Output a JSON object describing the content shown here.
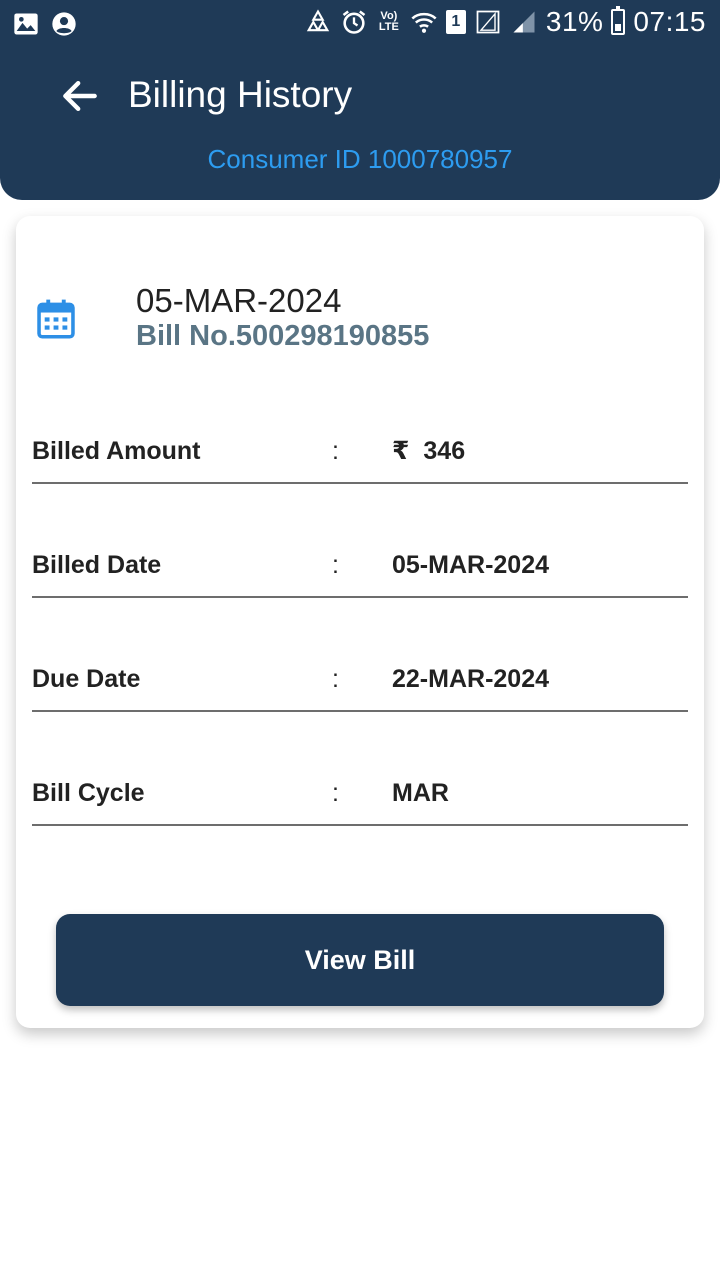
{
  "status_bar": {
    "battery": "31%",
    "time": "07:15",
    "volte": "Vo) LTE",
    "sim": "1",
    "icons": [
      "gallery-icon",
      "account-icon",
      "recycle-icon",
      "alarm-icon",
      "volte-icon",
      "wifi-icon",
      "sim-icon",
      "signal-icon",
      "signal-icon",
      "battery-icon"
    ]
  },
  "header": {
    "title": "Billing History",
    "consumer_id": "Consumer ID 1000780957",
    "back_icon": "arrow-left-icon"
  },
  "bill": {
    "icon": "calendar-icon",
    "date": "05-MAR-2024",
    "bill_no": "Bill No.500298190855",
    "colon": ":",
    "currency": "₹",
    "rows": [
      {
        "label": "Billed Amount",
        "value": "346"
      },
      {
        "label": "Billed Date",
        "value": "05-MAR-2024"
      },
      {
        "label": "Due Date",
        "value": "22-MAR-2024"
      },
      {
        "label": "Bill Cycle",
        "value": "MAR"
      }
    ],
    "view_button": "View Bill"
  },
  "colors": {
    "header_bg": "#1f3a57",
    "accent_blue": "#2d9cf0",
    "bill_no_color": "#5a7585",
    "button_bg": "#1f3a57"
  }
}
